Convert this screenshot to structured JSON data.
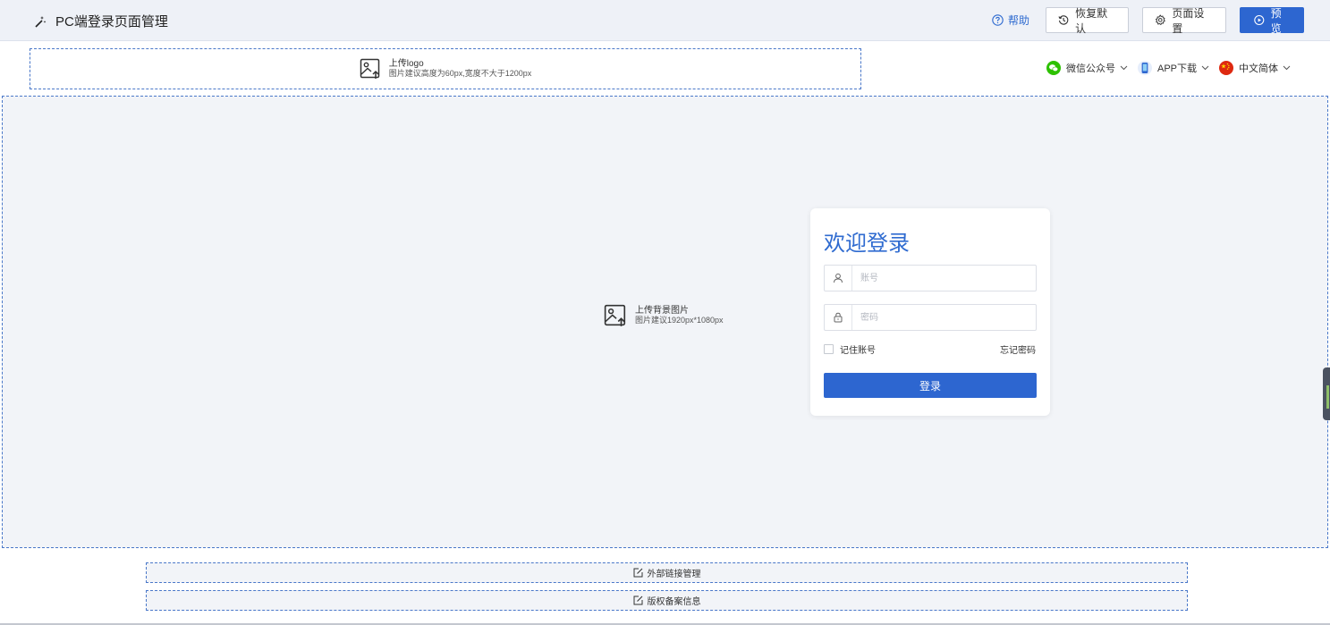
{
  "header": {
    "title": "PC端登录页面管理",
    "help_label": "帮助",
    "restore_label": "恢复默认",
    "settings_label": "页面设置",
    "preview_label": "预览"
  },
  "logo_upload": {
    "title": "上传logo",
    "hint": "图片建议高度为60px,宽度不大于1200px"
  },
  "top_nav": {
    "wechat_label": "微信公众号",
    "app_label": "APP下载",
    "lang_label": "中文简体"
  },
  "background_upload": {
    "title": "上传背景图片",
    "hint": "图片建议1920px*1080px"
  },
  "login": {
    "title": "欢迎登录",
    "account_placeholder": "账号",
    "password_placeholder": "密码",
    "remember_label": "记住账号",
    "forgot_label": "忘记密码",
    "submit_label": "登录"
  },
  "footer": {
    "links_label": "外部链接管理",
    "icp_label": "版权备案信息"
  },
  "colors": {
    "primary": "#2d66d0",
    "header_bg": "#eef1f7",
    "canvas_bg": "#f2f4f8",
    "dashed_border": "#4a78c9"
  }
}
